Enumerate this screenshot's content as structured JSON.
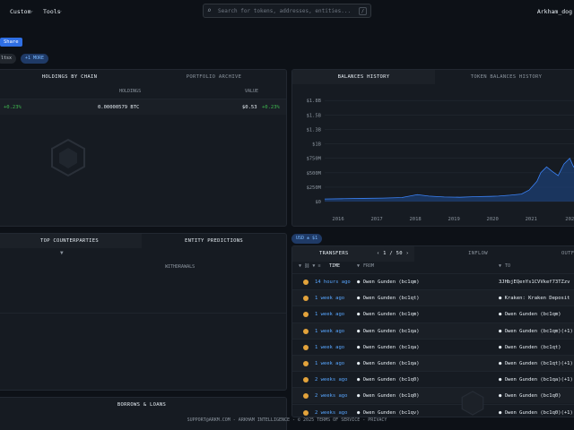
{
  "nav": {
    "custom": "Custom",
    "tools": "Tools",
    "search_placeholder": "Search for tokens, addresses, entities...",
    "search_shortcut": "/",
    "user": "Arkham_dog"
  },
  "share_label": "Share",
  "chips": [
    "ltsx",
    "+1 MORE"
  ],
  "holdings": {
    "tabs": [
      "HOLDINGS BY CHAIN",
      "PORTFOLIO ARCHIVE"
    ],
    "col_holdings": "HOLDINGS",
    "col_value": "VALUE",
    "row": {
      "change_left": "+0.23%",
      "holdings": "0.00000579 BTC",
      "value": "$0.53",
      "change": "+0.23%"
    }
  },
  "counterparties": {
    "tabs": [
      "TOP COUNTERPARTIES",
      "ENTITY PREDICTIONS"
    ],
    "withdrawals_label": "WITHDRAWALS"
  },
  "borrows_label": "BORROWS & LOANS",
  "balances": {
    "tabs": [
      "BALANCES HISTORY",
      "TOKEN BALANCES HISTORY"
    ],
    "usd_chip": "USD ± $1"
  },
  "chart_data": {
    "type": "area",
    "title": "",
    "y_ticks": [
      "$0",
      "$250M",
      "$500M",
      "$750M",
      "$1B",
      "$1.3B",
      "$1.5B",
      "$1.8B"
    ],
    "x_ticks": [
      "2016",
      "2017",
      "2018",
      "2019",
      "2020",
      "2021",
      "202"
    ],
    "ylim": [
      0,
      1800
    ],
    "series": [
      {
        "x": [
          2015.5,
          2016,
          2016.5,
          2017,
          2017.5,
          2017.9,
          2018.2,
          2018.6,
          2019,
          2019.4,
          2019.8,
          2020,
          2020.3,
          2020.6,
          2020.8,
          2021,
          2021.1,
          2021.25,
          2021.4,
          2021.55,
          2021.7,
          2021.85,
          2021.95,
          2022.1
        ],
        "values": [
          45,
          50,
          55,
          60,
          70,
          120,
          95,
          80,
          75,
          85,
          90,
          95,
          110,
          130,
          200,
          350,
          500,
          600,
          520,
          450,
          650,
          750,
          600,
          700
        ]
      }
    ]
  },
  "transfers": {
    "tabs": [
      "TRANSFERS",
      "INFLOW",
      "OUTFL"
    ],
    "pager": "1 / 50",
    "headers": {
      "time": "TIME",
      "from": "FROM",
      "to": "TO"
    },
    "rows": [
      {
        "time": "14 hours ago",
        "from": "Owen Gunden (bc1qm)",
        "to": "3JHbjEQenYs1CVVkef73TZzv"
      },
      {
        "time": "1 week ago",
        "from": "Owen Gunden (bc1qt)",
        "to": "Kraken: Kraken Deposit"
      },
      {
        "time": "1 week ago",
        "from": "Owen Gunden (bc1qm)",
        "to": "Owen Gunden (bc1qm)"
      },
      {
        "time": "1 week ago",
        "from": "Owen Gunden (bc1qa)",
        "to": "Owen Gunden (bc1qm)(+1)"
      },
      {
        "time": "1 week ago",
        "from": "Owen Gunden (bc1qa)",
        "to": "Owen Gunden (bc1qt)"
      },
      {
        "time": "1 week ago",
        "from": "Owen Gunden (bc1qa)",
        "to": "Owen Gunden (bc1qt)(+1)"
      },
      {
        "time": "2 weeks ago",
        "from": "Owen Gunden (bc1q0)",
        "to": "Owen Gunden (bc1qa)(+1)"
      },
      {
        "time": "2 weeks ago",
        "from": "Owen Gunden (bc1q0)",
        "to": "Owen Gunden (bc1q0)"
      },
      {
        "time": "2 weeks ago",
        "from": "Owen Gunden (bc1qv)",
        "to": "Owen Gunden (bc1q0)(+1)"
      }
    ]
  },
  "footer": "SUPPORT@ARKM.COM - ARKHAM INTELLIGENCE - © 2025 TERMS OF SERVICE - PRIVACY"
}
